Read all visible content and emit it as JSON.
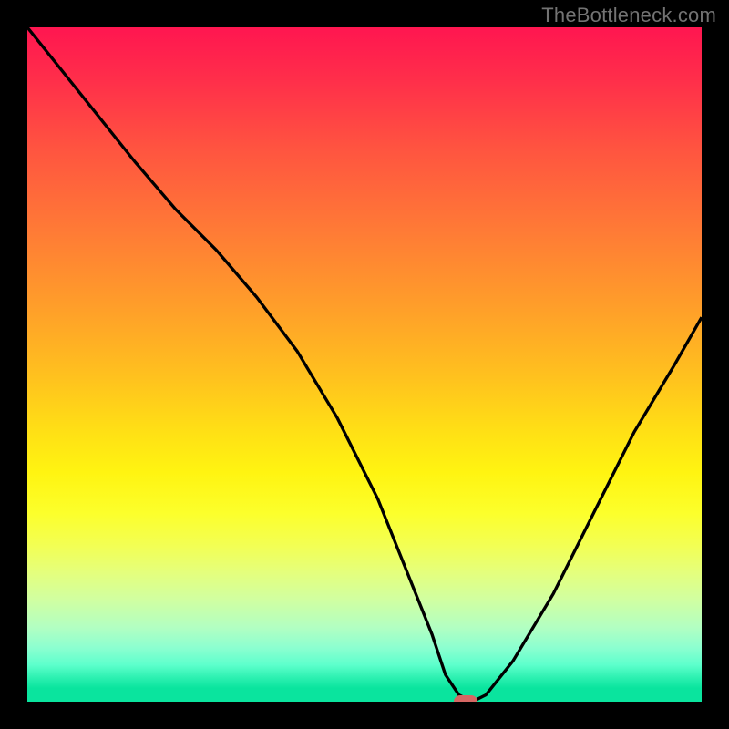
{
  "watermark": "TheBottleneck.com",
  "colors": {
    "page_bg": "#000000",
    "curve": "#000000",
    "marker": "#d66763",
    "watermark_text": "#737373",
    "gradient_top": "#ff1650",
    "gradient_bottom": "#0ae49e"
  },
  "chart_data": {
    "type": "line",
    "title": "",
    "xlabel": "",
    "ylabel": "",
    "xlim": [
      0,
      100
    ],
    "ylim": [
      0,
      100
    ],
    "grid": false,
    "curve": {
      "name": "bottleneck-curve",
      "x": [
        0,
        8,
        16,
        22,
        28,
        34,
        40,
        46,
        52,
        56,
        60,
        62,
        64,
        66,
        68,
        72,
        78,
        84,
        90,
        96,
        100
      ],
      "y": [
        100,
        90,
        80,
        73,
        67,
        60,
        52,
        42,
        30,
        20,
        10,
        4,
        1,
        0,
        1,
        6,
        16,
        28,
        40,
        50,
        57
      ]
    },
    "marker": {
      "x": 65,
      "y": 0
    },
    "annotations": []
  }
}
